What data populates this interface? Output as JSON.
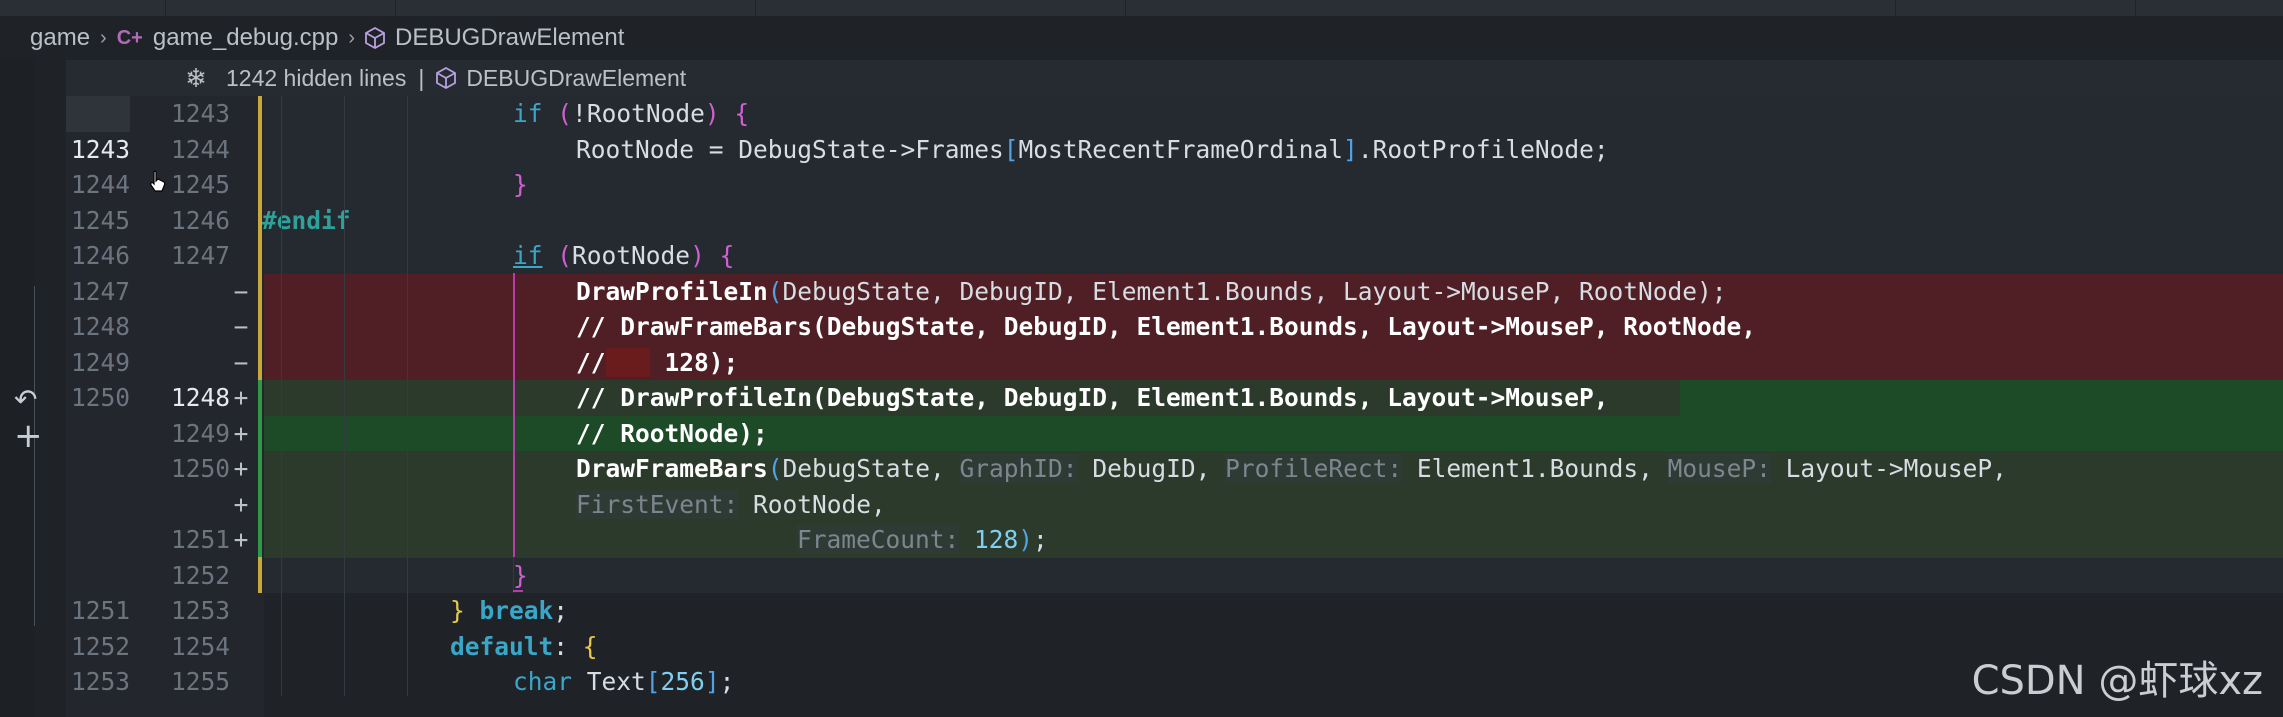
{
  "breadcrumb": {
    "folder": "game",
    "file": "game_debug.cpp",
    "symbol": "DEBUGDrawElement",
    "file_icon": "c++-file-icon",
    "symbol_icon": "cube-icon"
  },
  "fold": {
    "hidden_text": "1242 hidden lines",
    "separator": "|",
    "symbol": "DEBUGDrawElement"
  },
  "lines": [
    {
      "old": "",
      "new": "1243",
      "mark": ""
    },
    {
      "old": "1243",
      "new": "1244",
      "mark": ""
    },
    {
      "old": "1244",
      "new": "1245",
      "mark": ""
    },
    {
      "old": "1245",
      "new": "1246",
      "mark": ""
    },
    {
      "old": "1246",
      "new": "1247",
      "mark": ""
    },
    {
      "old": "1247",
      "new": "",
      "mark": "−"
    },
    {
      "old": "1248",
      "new": "",
      "mark": "−"
    },
    {
      "old": "1249",
      "new": "",
      "mark": "−"
    },
    {
      "old": "1250",
      "new": "1248",
      "mark": "+"
    },
    {
      "old": "",
      "new": "1249",
      "mark": "+"
    },
    {
      "old": "",
      "new": "1250",
      "mark": "+"
    },
    {
      "old": "",
      "new": "",
      "mark": "+"
    },
    {
      "old": "",
      "new": "1251",
      "mark": "+"
    },
    {
      "old": "",
      "new": "1252",
      "mark": ""
    },
    {
      "old": "1251",
      "new": "1253",
      "mark": ""
    },
    {
      "old": "1252",
      "new": "1254",
      "mark": ""
    },
    {
      "old": "1253",
      "new": "1255",
      "mark": ""
    }
  ],
  "code": {
    "l0": {
      "kw": "if",
      "open": "(",
      "op": "!",
      "id": "RootNode",
      "close": ")",
      "brace": "{"
    },
    "l1": {
      "a": "RootNode = DebugState->Frames",
      "b1": "[",
      "c": "MostRecentFrameOrdinal",
      "b2": "]",
      "d": ".RootProfileNode;"
    },
    "l2": {
      "brace": "}"
    },
    "l3": {
      "pp": "#endif"
    },
    "l4": {
      "kw": "if",
      "open": "(",
      "id": "RootNode",
      "close": ")",
      "brace": "{"
    },
    "l5": {
      "fn": "DrawProfileIn",
      "open": "(",
      "args": "DebugState, DebugID, Element1.Bounds, Layout->MouseP, RootNode",
      "close": ");"
    },
    "l6": {
      "text": "// DrawFrameBars(DebugState, DebugID, Element1.Bounds, Layout->MouseP, RootNode,"
    },
    "l7": {
      "a": "//",
      "b": "   ",
      "c": " 128);"
    },
    "l8": {
      "text": "// DrawProfileIn(DebugState, DebugID, Element1.Bounds, Layout->MouseP,"
    },
    "l9": {
      "text": "// RootNode);"
    },
    "l10": {
      "fn": "DrawFrameBars",
      "open": "(",
      "a1": "DebugState, ",
      "h1": "GraphID:",
      "a2": " DebugID, ",
      "h2": "ProfileRect:",
      "a3": " Element1.Bounds, ",
      "h3": "MouseP:",
      "a4": " Layout->MouseP,"
    },
    "l11": {
      "h": "FirstEvent:",
      "a": " RootNode,"
    },
    "l12": {
      "h": "FrameCount:",
      "num": " 128",
      "close": ")",
      "semi": ";"
    },
    "l13": {
      "brace": "}"
    },
    "l14": {
      "brace": "}",
      "kw": " break",
      "semi": ";"
    },
    "l15": {
      "kw": "default",
      "colon": ": ",
      "brace": "{"
    },
    "l16": {
      "kw": "char",
      "id": " Text",
      "b1": "[",
      "num": "256",
      "b2": "]",
      "semi": ";"
    }
  },
  "left_icons": {
    "undo": "undo-arrow-icon",
    "add": "plus-icon"
  },
  "watermark": "CSDN @虾球xz",
  "colors": {
    "deleted": "#4f1f25",
    "added": "#2c3a2c",
    "added_strong": "#1d4a27",
    "keyword": "#3aa6c8"
  }
}
